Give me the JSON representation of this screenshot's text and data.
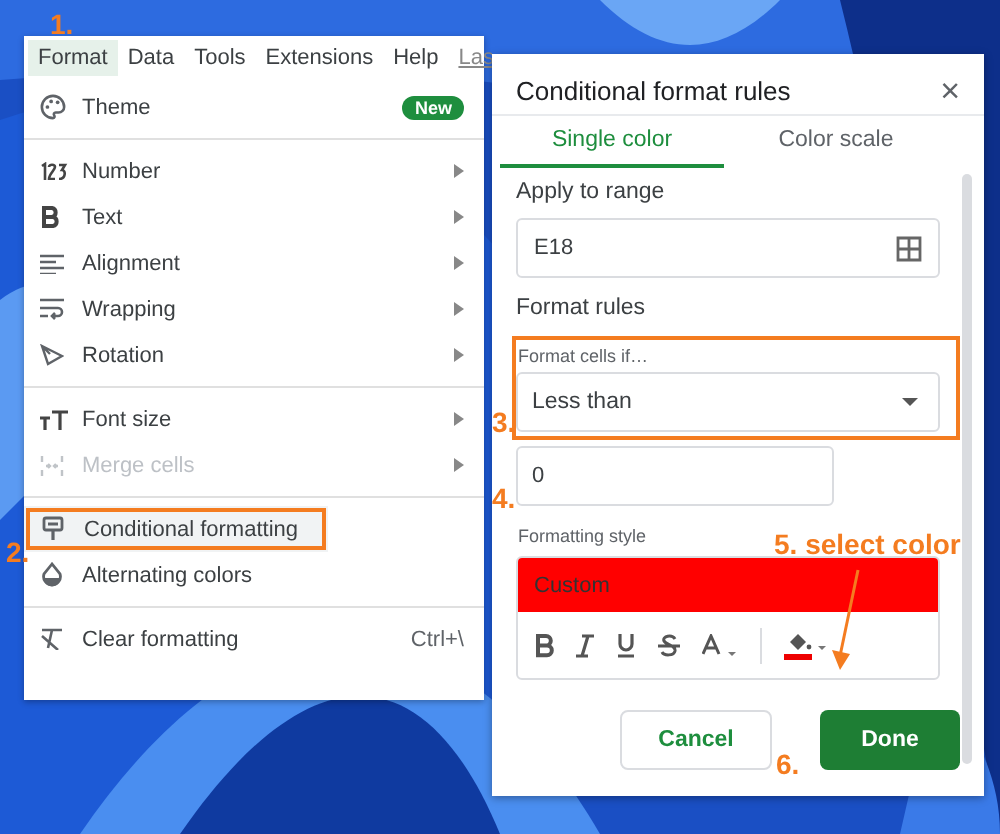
{
  "menu_bar": [
    {
      "label": "Format",
      "selected": true
    },
    {
      "label": "Data",
      "selected": false
    },
    {
      "label": "Tools",
      "selected": false
    },
    {
      "label": "Extensions",
      "selected": false
    },
    {
      "label": "Help",
      "selected": false
    },
    {
      "label": "Las",
      "selected": false
    }
  ],
  "menu_sections": [
    [
      {
        "label": "Theme",
        "badge": "New",
        "submenu": false,
        "disabled": false,
        "selected": false,
        "outlined": false
      }
    ],
    [
      {
        "label": "Number",
        "submenu": true,
        "disabled": false,
        "selected": false,
        "outlined": false
      },
      {
        "label": "Text",
        "submenu": true,
        "disabled": false,
        "selected": false,
        "outlined": false
      },
      {
        "label": "Alignment",
        "submenu": true,
        "disabled": false,
        "selected": false,
        "outlined": false
      },
      {
        "label": "Wrapping",
        "submenu": true,
        "disabled": false,
        "selected": false,
        "outlined": false
      },
      {
        "label": "Rotation",
        "submenu": true,
        "disabled": false,
        "selected": false,
        "outlined": false
      }
    ],
    [
      {
        "label": "Font size",
        "submenu": true,
        "disabled": false,
        "selected": false,
        "outlined": false
      },
      {
        "label": "Merge cells",
        "submenu": true,
        "disabled": true,
        "selected": false,
        "outlined": false
      }
    ],
    [
      {
        "label": "Conditional formatting",
        "submenu": false,
        "disabled": false,
        "selected": true,
        "outlined": true
      },
      {
        "label": "Alternating colors",
        "submenu": false,
        "disabled": false,
        "selected": false,
        "outlined": false
      }
    ],
    [
      {
        "label": "Clear formatting",
        "shortcut": "Ctrl+\\",
        "submenu": false,
        "disabled": false,
        "selected": false,
        "outlined": false
      }
    ]
  ],
  "dialog": {
    "title": "Conditional format rules",
    "close": "×",
    "tabs": [
      {
        "label": "Single color",
        "selected": true
      },
      {
        "label": "Color scale",
        "selected": false
      }
    ],
    "range_label": "Apply to range",
    "range_value": "E18",
    "rules_label": "Format rules",
    "condition_label": "Format cells if…",
    "condition_value": "Less than",
    "condition_outlined": true,
    "value": "0",
    "style_label": "Formatting style",
    "preview": "Custom",
    "buttons": [
      {
        "label": "Cancel",
        "kind": "secondary"
      },
      {
        "label": "Done",
        "kind": "primary"
      }
    ]
  },
  "annotations": [
    "1.",
    "2.",
    "3.",
    "4.",
    "5. select color",
    "6."
  ]
}
